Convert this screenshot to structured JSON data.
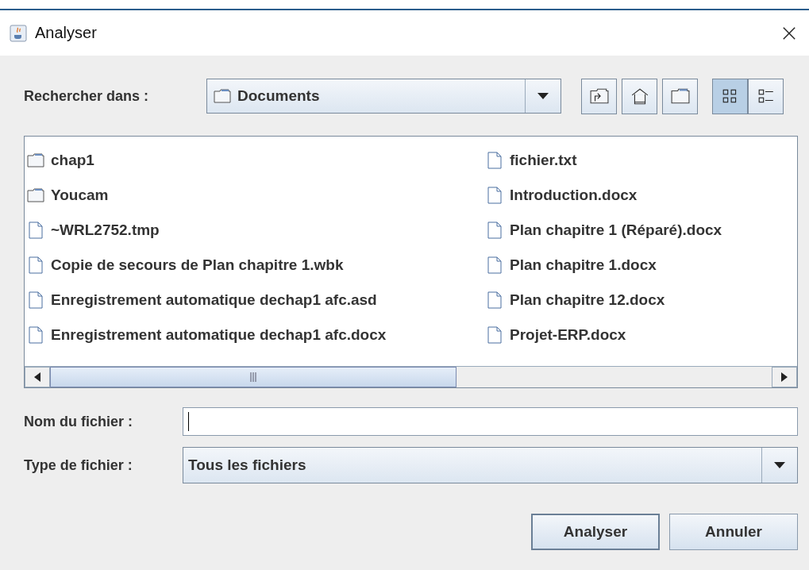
{
  "window": {
    "title": "Analyser"
  },
  "look_in": {
    "label": "Rechercher dans :",
    "value": "Documents"
  },
  "view_buttons": [
    {
      "kind": "list",
      "selected": true
    },
    {
      "kind": "details",
      "selected": false
    }
  ],
  "files": [
    {
      "kind": "folder",
      "name": "chap1"
    },
    {
      "kind": "folder",
      "name": "Youcam"
    },
    {
      "kind": "file",
      "name": "~WRL2752.tmp"
    },
    {
      "kind": "file",
      "name": "Copie de secours de Plan chapitre 1.wbk"
    },
    {
      "kind": "file",
      "name": "Enregistrement automatique dechap1 afc.asd"
    },
    {
      "kind": "file",
      "name": "Enregistrement automatique dechap1 afc.docx"
    },
    {
      "kind": "file",
      "name": "fichier.txt"
    },
    {
      "kind": "file",
      "name": "Introduction.docx"
    },
    {
      "kind": "file",
      "name": "Plan chapitre 1 (Réparé).docx"
    },
    {
      "kind": "file",
      "name": "Plan chapitre 1.docx"
    },
    {
      "kind": "file",
      "name": "Plan chapitre 12.docx"
    },
    {
      "kind": "file",
      "name": "Projet-ERP.docx"
    }
  ],
  "file_name": {
    "label": "Nom du fichier :"
  },
  "file_type": {
    "label": "Type de fichier :",
    "value": "Tous les fichiers"
  },
  "buttons": [
    {
      "label": "Analyser",
      "default": true
    },
    {
      "label": "Annuler",
      "default": false
    }
  ]
}
